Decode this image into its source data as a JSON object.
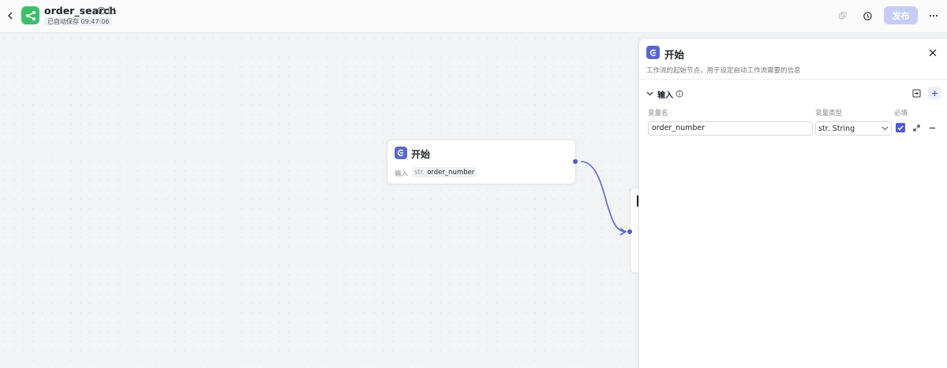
{
  "header": {
    "title": "order_search",
    "autosave": "已自动保存 09:47:06",
    "publish_label": "发布"
  },
  "canvas": {
    "start_node": {
      "title": "开始",
      "input_label": "输入",
      "variable_type": "str.",
      "variable_name": "order_number"
    }
  },
  "panel": {
    "title": "开始",
    "description": "工作流的起始节点，用于设定启动工作流需要的信息",
    "section_label": "输入",
    "columns": {
      "name": "变量名",
      "type": "变量类型",
      "required": "必填"
    },
    "row": {
      "name_value": "order_number",
      "type_value": "str. String",
      "required": true
    }
  },
  "colors": {
    "accent": "#4f5bd5",
    "node_icon": "#5a67cf",
    "logo_green": "#3bbf6a",
    "publish_disabled": "#c5cdf7"
  },
  "icons": [
    "back-icon",
    "workflow-logo-icon",
    "info-icon",
    "edit-icon",
    "copy-icon",
    "history-icon",
    "more-icon",
    "start-node-icon",
    "close-icon",
    "chevron-down-icon",
    "import-icon",
    "plus-icon",
    "expand-icon",
    "minus-icon"
  ]
}
